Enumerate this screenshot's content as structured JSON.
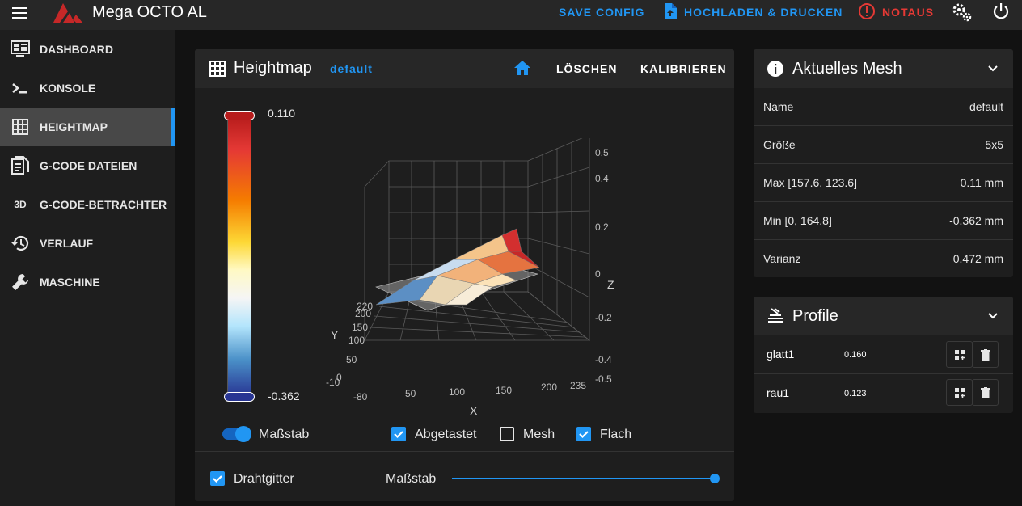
{
  "app": {
    "title": "Mega OCTO AL",
    "save_config": "SAVE CONFIG",
    "upload_print": "HOCHLADEN & DRUCKEN",
    "emergency": "NOTAUS",
    "colors": {
      "accent": "#2196f3",
      "emergency": "#e53935",
      "brand": "#c62828"
    }
  },
  "sidebar": {
    "items": [
      {
        "label": "DASHBOARD",
        "icon": "monitor-dashboard-icon"
      },
      {
        "label": "KONSOLE",
        "icon": "console-icon"
      },
      {
        "label": "HEIGHTMAP",
        "icon": "grid-icon"
      },
      {
        "label": "G-CODE DATEIEN",
        "icon": "file-document-icon"
      },
      {
        "label": "G-CODE-BETRACHTER",
        "icon": "3d-icon"
      },
      {
        "label": "VERLAUF",
        "icon": "history-icon"
      },
      {
        "label": "MASCHINE",
        "icon": "wrench-icon"
      }
    ],
    "icon_3d_text": "3D",
    "active": "HEIGHTMAP"
  },
  "heightmap": {
    "title": "Heightmap",
    "profile": "default",
    "delete_label": "LÖSCHEN",
    "calibrate_label": "KALIBRIEREN",
    "scale_max": "0.110",
    "scale_min": "-0.362",
    "axes": {
      "x_label": "X",
      "y_label": "Y",
      "z_label": "Z",
      "x_ticks": [
        "-80",
        "50",
        "100",
        "150",
        "200",
        "235"
      ],
      "y_ticks": [
        "-10",
        "0",
        "50",
        "100",
        "150",
        "200",
        "220"
      ],
      "z_ticks": [
        "0.5",
        "0.4",
        "0.2",
        "0",
        "-0.2",
        "-0.4",
        "-0.5"
      ]
    },
    "options": {
      "scale_toggle": "Maßstab",
      "probed": "Abgetastet",
      "mesh": "Mesh",
      "flat": "Flach",
      "wireframe": "Drahtgitter",
      "scale_slider": "Maßstab"
    }
  },
  "mesh": {
    "title": "Aktuelles Mesh",
    "rows": [
      {
        "key": "Name",
        "value": "default"
      },
      {
        "key": "Größe",
        "value": "5x5"
      },
      {
        "key": "Max [157.6, 123.6]",
        "value": "0.11 mm"
      },
      {
        "key": "Min [0, 164.8]",
        "value": "-0.362 mm"
      },
      {
        "key": "Varianz",
        "value": "0.472 mm"
      }
    ]
  },
  "profiles": {
    "title": "Profile",
    "items": [
      {
        "name": "glatt1",
        "value": "0.160"
      },
      {
        "name": "rau1",
        "value": "0.123"
      }
    ]
  }
}
